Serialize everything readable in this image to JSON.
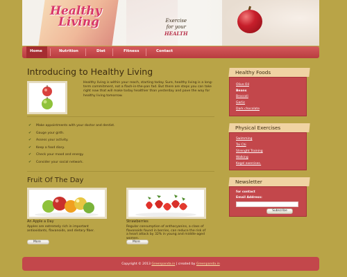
{
  "header": {
    "logo_line1": "Healthy",
    "logo_line2": "Living",
    "tagline_line1": "Exercise",
    "tagline_line2": "for your",
    "tagline_line3": "HEALTH"
  },
  "nav": {
    "items": [
      {
        "label": "Home"
      },
      {
        "label": "Nutrition"
      },
      {
        "label": "Diet"
      },
      {
        "label": "Fitness"
      },
      {
        "label": "Contact"
      }
    ]
  },
  "main": {
    "title": "Introducing to Healthy Living",
    "intro": "Healthy living is within your reach, starting today. Sure, healthy living is a long-term commitment, not a flash-in-the-pan fad. But there are steps you can take right now that will make today healthier than yesterday and pave the way for healthy living tomorrow.",
    "checklist": [
      "Make appointments with your doctor and dentist.",
      "Gauge your girth.",
      "Assess your activity.",
      "Keep a food diary.",
      "Check your mood and energy.",
      "Consider your social network."
    ],
    "fruit_title": "Fruit Of The Day",
    "fruits": [
      {
        "name": "An Apple a Day",
        "desc": "Apples are extremely rich in important antioxidants, flavanoids, and dietary fiber.",
        "more": "More"
      },
      {
        "name": "Strawberries",
        "desc": "Regular consumption of anthocyanins, a class of flavonoids found in berries, can reduce the risk of a heart attack by 32% in young and middle-aged women.",
        "more": "More"
      }
    ]
  },
  "sidebar": {
    "healthy_foods": {
      "title": "Healthy Foods",
      "items": [
        "Olive Oil",
        "Beans",
        "Broccoli",
        "Garlic",
        "Dark chocolate"
      ]
    },
    "physical_exercises": {
      "title": "Physical Exercises",
      "items": [
        "Swimming",
        "Tai Chi",
        "Strenght Training",
        "Walking",
        "Kegel exercises."
      ]
    },
    "newsletter": {
      "title": "Newsletter",
      "for_contact": "for contact",
      "email_label": "Email Address:",
      "subscribe": "Subscribe"
    }
  },
  "footer": {
    "copyright": "Copyright © 2013",
    "link1": "Greenpanda.in",
    "created_by": "| created by",
    "link2": "Greenpanda.in"
  },
  "colors": {
    "background": "#b9a447",
    "accent_red": "#c3474b",
    "sidebar_header": "#f0d3a3",
    "logo_pink": "#d8386a"
  }
}
